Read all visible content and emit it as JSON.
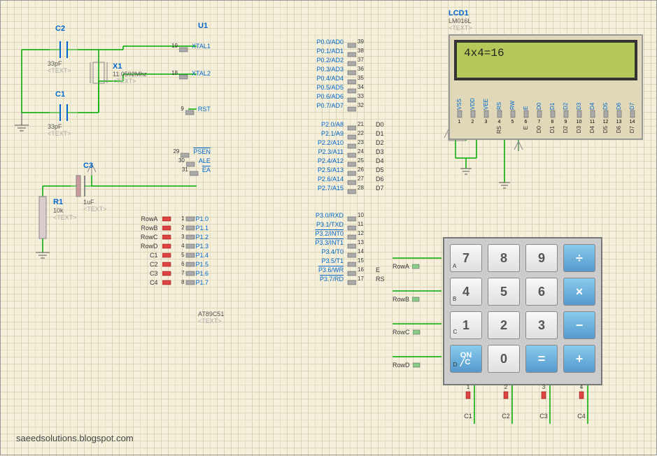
{
  "components": {
    "u1": {
      "ref": "U1",
      "part": "AT89C51",
      "text": "<TEXT>"
    },
    "c1": {
      "ref": "C1",
      "value": "33pF",
      "text": "<TEXT>"
    },
    "c2": {
      "ref": "C2",
      "value": "33pF",
      "text": "<TEXT>"
    },
    "c3": {
      "ref": "C3",
      "value": "1uF",
      "text": "<TEXT>"
    },
    "x1": {
      "ref": "X1",
      "value": "11.0592Mhz",
      "text": "<TEXT>"
    },
    "r1": {
      "ref": "R1",
      "value": "10k",
      "text": "<TEXT>"
    },
    "lcd1": {
      "ref": "LCD1",
      "part": "LM016L",
      "text": "<TEXT>",
      "display": "4x4=16"
    }
  },
  "u1_pins_left_top": [
    {
      "num": "19",
      "name": "XTAL1"
    },
    {
      "num": "18",
      "name": "XTAL2"
    },
    {
      "num": "9",
      "name": "RST"
    },
    {
      "num": "29",
      "name": "PSEN",
      "bar": true
    },
    {
      "num": "30",
      "name": "ALE"
    },
    {
      "num": "31",
      "name": "EA",
      "bar": true
    }
  ],
  "u1_pins_left_p1": [
    {
      "num": "1",
      "name": "P1.0"
    },
    {
      "num": "2",
      "name": "P1.1"
    },
    {
      "num": "3",
      "name": "P1.2"
    },
    {
      "num": "4",
      "name": "P1.3"
    },
    {
      "num": "5",
      "name": "P1.4"
    },
    {
      "num": "6",
      "name": "P1.5"
    },
    {
      "num": "7",
      "name": "P1.6"
    },
    {
      "num": "8",
      "name": "P1.7"
    }
  ],
  "u1_pins_right_p0": [
    {
      "num": "39",
      "name": "P0.0/AD0"
    },
    {
      "num": "38",
      "name": "P0.1/AD1"
    },
    {
      "num": "37",
      "name": "P0.2/AD2"
    },
    {
      "num": "36",
      "name": "P0.3/AD3"
    },
    {
      "num": "35",
      "name": "P0.4/AD4"
    },
    {
      "num": "34",
      "name": "P0.5/AD5"
    },
    {
      "num": "33",
      "name": "P0.6/AD6"
    },
    {
      "num": "32",
      "name": "P0.7/AD7"
    }
  ],
  "u1_pins_right_p2": [
    {
      "num": "21",
      "name": "P2.0/A8",
      "net": "D0"
    },
    {
      "num": "22",
      "name": "P2.1/A9",
      "net": "D1"
    },
    {
      "num": "23",
      "name": "P2.2/A10",
      "net": "D2"
    },
    {
      "num": "24",
      "name": "P2.3/A11",
      "net": "D3"
    },
    {
      "num": "25",
      "name": "P2.4/A12",
      "net": "D4"
    },
    {
      "num": "26",
      "name": "P2.5/A13",
      "net": "D5"
    },
    {
      "num": "27",
      "name": "P2.6/A14",
      "net": "D6"
    },
    {
      "num": "28",
      "name": "P2.7/A15",
      "net": "D7"
    }
  ],
  "u1_pins_right_p3": [
    {
      "num": "10",
      "name": "P3.0/RXD"
    },
    {
      "num": "11",
      "name": "P3.1/TXD"
    },
    {
      "num": "12",
      "name": "P3.2/INT0",
      "bar": true
    },
    {
      "num": "13",
      "name": "P3.3/INT1",
      "bar": true
    },
    {
      "num": "14",
      "name": "P3.4/T0"
    },
    {
      "num": "15",
      "name": "P3.5/T1"
    },
    {
      "num": "16",
      "name": "P3.6/WR",
      "bar": true,
      "net": "E"
    },
    {
      "num": "17",
      "name": "P3.7/RD",
      "bar": true,
      "net": "RS"
    }
  ],
  "p1_nets": [
    "RowA",
    "RowB",
    "RowC",
    "RowD",
    "C1",
    "C2",
    "C3",
    "C4"
  ],
  "lcd_pins": [
    {
      "name": "VSS",
      "num": "1"
    },
    {
      "name": "VDD",
      "num": "2"
    },
    {
      "name": "VEE",
      "num": "3"
    },
    {
      "name": "RS",
      "num": "4",
      "net": "RS"
    },
    {
      "name": "RW",
      "num": "5"
    },
    {
      "name": "E",
      "num": "6",
      "net": "E"
    },
    {
      "name": "D0",
      "num": "7",
      "net": "D0"
    },
    {
      "name": "D1",
      "num": "8",
      "net": "D1"
    },
    {
      "name": "D2",
      "num": "9",
      "net": "D2"
    },
    {
      "name": "D3",
      "num": "10",
      "net": "D3"
    },
    {
      "name": "D4",
      "num": "11",
      "net": "D4"
    },
    {
      "name": "D5",
      "num": "12",
      "net": "D5"
    },
    {
      "name": "D6",
      "num": "13",
      "net": "D6"
    },
    {
      "name": "D7",
      "num": "14",
      "net": "D7"
    }
  ],
  "keypad": {
    "rows": [
      [
        "7",
        "8",
        "9",
        "÷"
      ],
      [
        "4",
        "5",
        "6",
        "×"
      ],
      [
        "1",
        "2",
        "3",
        "−"
      ],
      [
        "ON/C",
        "0",
        "=",
        "+"
      ]
    ],
    "row_labels": [
      "A",
      "B",
      "C",
      "D"
    ],
    "row_nets": [
      "RowA",
      "RowB",
      "RowC",
      "RowD"
    ],
    "col_nums": [
      "1",
      "2",
      "3",
      "4"
    ],
    "col_nets": [
      "C1",
      "C2",
      "C3",
      "C4"
    ]
  },
  "watermark": "saeedsolutions.blogspot.com"
}
